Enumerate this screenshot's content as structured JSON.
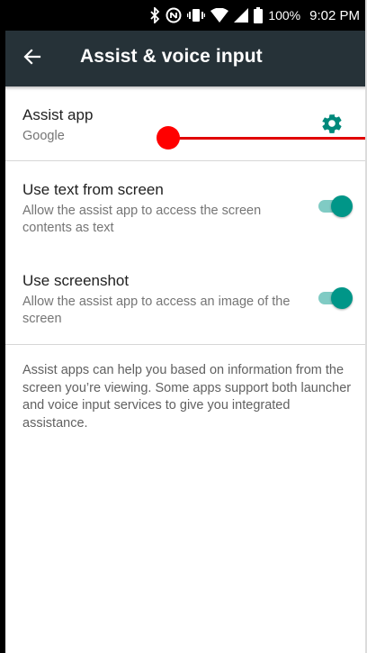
{
  "status_bar": {
    "icons": [
      "bluetooth-icon",
      "nfc-icon",
      "vibrate-icon",
      "wifi-icon",
      "signal-icon",
      "battery-icon"
    ],
    "battery_percent": "100%",
    "time": "9:02 PM"
  },
  "app_bar": {
    "back_icon": "arrow-back-icon",
    "title": "Assist & voice input"
  },
  "settings": {
    "assist_app": {
      "title": "Assist app",
      "value": "Google",
      "settings_icon": "gear-icon"
    },
    "use_text": {
      "title": "Use text from screen",
      "summary": "Allow the assist app to access the screen contents as text",
      "enabled": true
    },
    "use_screenshot": {
      "title": "Use screenshot",
      "summary": "Allow the assist app to access an image of the screen",
      "enabled": true
    }
  },
  "footer": {
    "text": "Assist apps can help you based on information from the screen you’re viewing. Some apps support both launcher and voice input services to give you integrated assistance."
  },
  "colors": {
    "app_bar": "#263238",
    "status_bar": "#000000",
    "accent": "#009688",
    "accent_track": "#80cbc4",
    "annotation": "#ff0000"
  }
}
